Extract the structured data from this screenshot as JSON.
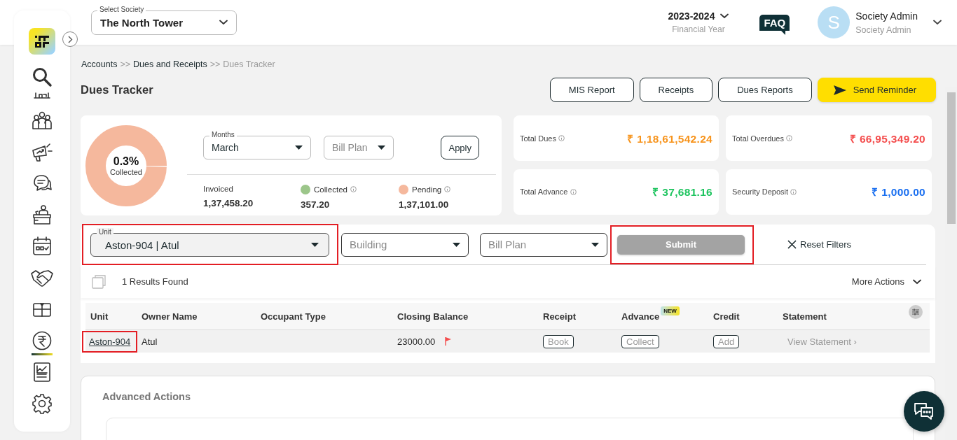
{
  "header": {
    "society_select": {
      "label": "Select Society",
      "value": "The North Tower"
    },
    "financial_year": {
      "value": "2023-2024",
      "caption": "Financial Year"
    },
    "faq_label": "FAQ",
    "user": {
      "initial": "S",
      "name": "Society Admin",
      "role": "Society Admin"
    }
  },
  "sidebar": {
    "items": [
      {
        "kind": "search",
        "selected": false
      },
      {
        "kind": "building",
        "selected": false
      },
      {
        "kind": "people",
        "selected": false
      },
      {
        "kind": "megaphone",
        "selected": false
      },
      {
        "kind": "chat",
        "selected": false
      },
      {
        "kind": "desk",
        "selected": false
      },
      {
        "kind": "calendar",
        "selected": false
      },
      {
        "kind": "handshake",
        "selected": false
      },
      {
        "kind": "box",
        "selected": false
      },
      {
        "kind": "rupee",
        "selected": true
      },
      {
        "kind": "report",
        "selected": false
      },
      {
        "kind": "settings",
        "selected": false
      }
    ]
  },
  "breadcrumb": [
    {
      "label": "Accounts",
      "kind": "link"
    },
    {
      "label": ">>",
      "kind": "separator"
    },
    {
      "label": "Dues and Receipts",
      "kind": "link"
    },
    {
      "label": ">>",
      "kind": "separator"
    },
    {
      "label": "Dues Tracker",
      "kind": "current"
    }
  ],
  "page_title": "Dues Tracker",
  "actions": [
    {
      "label": "MIS Report",
      "kind": "outline"
    },
    {
      "label": "Receipts",
      "kind": "outline"
    },
    {
      "label": "Dues Reports",
      "kind": "outline"
    },
    {
      "label": "Send Reminder",
      "kind": "primary"
    }
  ],
  "summary": {
    "donut": {
      "level": 0.003
    },
    "center_value": "0.3%",
    "center_label": "Collected",
    "months": {
      "label": "Months",
      "value": "March"
    },
    "bill_plan": {
      "placeholder": "Bill Plan"
    },
    "apply_label": "Apply",
    "stats": [
      {
        "label": "Invoiced",
        "value": "1,37,458.20",
        "kind": "plain"
      },
      {
        "label": "Collected",
        "value": "357.20",
        "kind": "legend",
        "color": "#9cc68a"
      },
      {
        "label": "Pending",
        "value": "1,37,101.00",
        "kind": "legend",
        "color": "#f5b89d"
      }
    ]
  },
  "totals": [
    {
      "label": "Total Dues",
      "value": "₹ 1,18,61,542.24",
      "color": "#f7941d"
    },
    {
      "label": "Total Overdues",
      "value": "₹ 66,95,349.20",
      "color": "#f44d4d"
    },
    {
      "label": "Total Advance",
      "value": "₹ 37,681.16",
      "color": "#1ec45f"
    },
    {
      "label": "Security Deposit",
      "value": "₹ 1,000.00",
      "color": "#1a6ff0"
    }
  ],
  "filter_bar": {
    "unit": {
      "label": "Unit",
      "value": "Aston-904 | Atul",
      "highlighted": true
    },
    "building": {
      "placeholder": "Building"
    },
    "bill_plan": {
      "placeholder": "Bill Plan"
    },
    "submit": {
      "label": "Submit",
      "disabled": true,
      "highlighted": true
    },
    "reset_label": "Reset Filters"
  },
  "results": {
    "count_text": "1 Results Found",
    "more_actions": "More Actions"
  },
  "table": {
    "columns": [
      {
        "label": "Unit"
      },
      {
        "label": "Owner Name"
      },
      {
        "label": "Occupant Type"
      },
      {
        "label": "Closing Balance"
      },
      {
        "label": "Receipt"
      },
      {
        "label": "Advance",
        "badge": "NEW"
      },
      {
        "label": "Credit"
      },
      {
        "label": "Statement"
      }
    ],
    "rows": [
      {
        "unit": "Aston-904",
        "highlighted": true,
        "owner_name": "Atul",
        "closing_balance": "23000.00",
        "flagged": true,
        "receipt": "Book",
        "advance": "Collect",
        "credit": "Add",
        "statement": "View Statement ›"
      }
    ]
  },
  "advanced_actions": {
    "title": "Advanced Actions"
  }
}
